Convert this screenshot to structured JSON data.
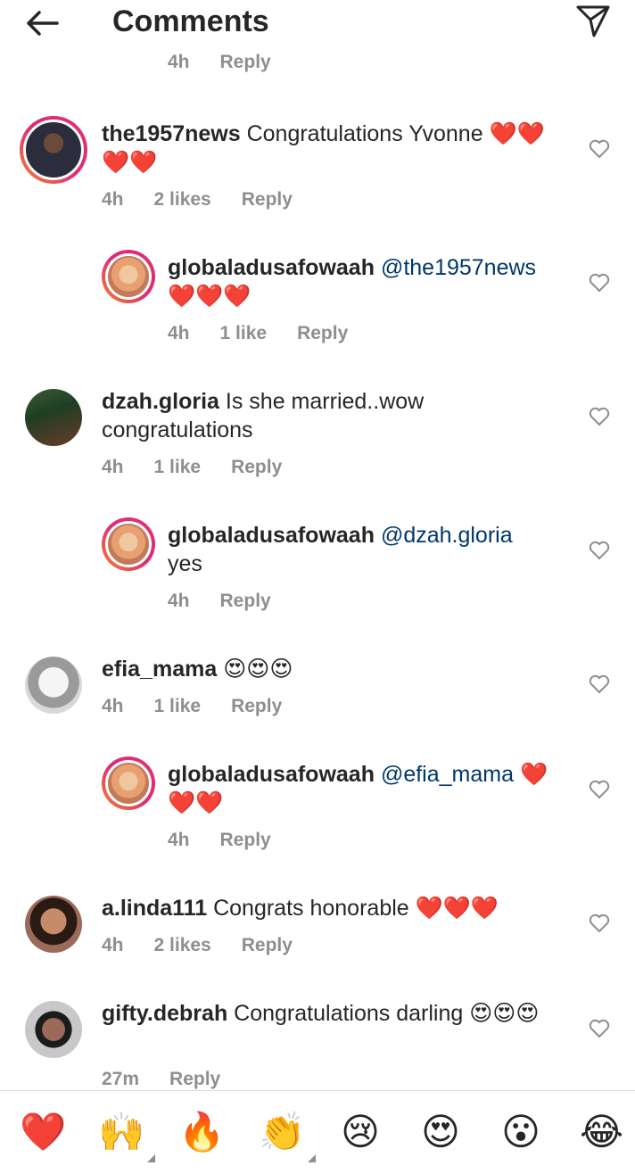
{
  "header": {
    "title": "Comments"
  },
  "cut_meta": {
    "time": "4h",
    "reply": "Reply"
  },
  "comments": [
    {
      "username": "the1957news",
      "mention": "",
      "text": " Congratulations Yvonne ",
      "emoji": "❤️❤️❤️❤️",
      "time": "4h",
      "likes": "2 likes",
      "reply": "Reply"
    },
    {
      "username": "globaladusafowaah",
      "mention": "@the1957news",
      "text": "",
      "emoji": "❤️❤️❤️",
      "time": "4h",
      "likes": "1 like",
      "reply": "Reply"
    },
    {
      "username": "dzah.gloria",
      "mention": "",
      "text": " Is she married..wow congratulations",
      "emoji": "",
      "time": "4h",
      "likes": "1 like",
      "reply": "Reply"
    },
    {
      "username": "globaladusafowaah",
      "mention": "@dzah.gloria",
      "text": " yes",
      "emoji": "",
      "time": "4h",
      "likes": "",
      "reply": "Reply"
    },
    {
      "username": "efia_mama",
      "mention": "",
      "text": " ",
      "emoji": "😍😍😍",
      "time": "4h",
      "likes": "1 like",
      "reply": "Reply"
    },
    {
      "username": "globaladusafowaah",
      "mention": "@efia_mama",
      "text": " ",
      "emoji": "❤️❤️❤️",
      "time": "4h",
      "likes": "",
      "reply": "Reply"
    },
    {
      "username": "a.linda111",
      "mention": "",
      "text": " Congrats honorable ",
      "emoji": "❤️❤️❤️",
      "time": "4h",
      "likes": "2 likes",
      "reply": "Reply"
    },
    {
      "username": "gifty.debrah",
      "mention": "",
      "text": " Congratulations darling ",
      "emoji": "😍😍😍",
      "time": "27m",
      "likes": "",
      "reply": "Reply"
    }
  ],
  "emoji_bar": [
    "❤️",
    "🙌",
    "🔥",
    "👏",
    "😢",
    "😍",
    "😮",
    "😂"
  ]
}
